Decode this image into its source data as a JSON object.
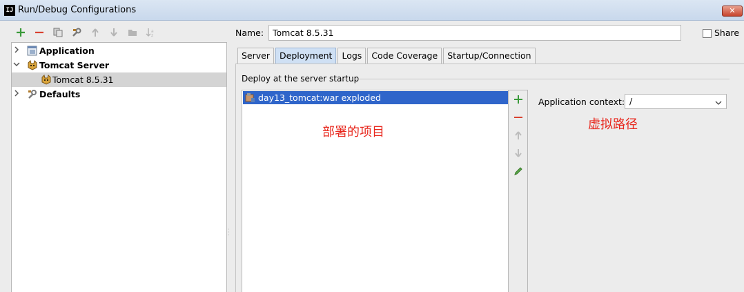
{
  "window": {
    "title": "Run/Debug Configurations",
    "app_icon_text": "IJ",
    "close_label": "✕"
  },
  "toolbar": {
    "icons": [
      "add-icon",
      "remove-icon",
      "copy-icon",
      "wrench-icon",
      "move-up-icon",
      "move-down-icon",
      "folder-icon",
      "sort-icon"
    ]
  },
  "tree": {
    "items": [
      {
        "label": "Application",
        "bold": true,
        "expanded": false
      },
      {
        "label": "Tomcat Server",
        "bold": true,
        "expanded": true
      },
      {
        "label": "Tomcat 8.5.31",
        "bold": false,
        "selected": true
      },
      {
        "label": "Defaults",
        "bold": true,
        "expanded": false
      }
    ]
  },
  "form": {
    "name_label": "Name:",
    "name_value": "Tomcat 8.5.31",
    "share_label": "Share",
    "share_checked": false
  },
  "tabs": [
    {
      "label": "Server",
      "active": false
    },
    {
      "label": "Deployment",
      "active": true
    },
    {
      "label": "Logs",
      "active": false
    },
    {
      "label": "Code Coverage",
      "active": false
    },
    {
      "label": "Startup/Connection",
      "active": false
    }
  ],
  "deployment": {
    "group_title": "Deploy at the server startup",
    "artifacts": [
      "day13_tomcat:war exploded"
    ],
    "context_label": "Application context:",
    "context_value": "/"
  },
  "annotations": {
    "project": "部署的项目",
    "virtual_path": "虚拟路径"
  },
  "colors": {
    "selection": "#2f65ca",
    "annotation": "#e8281e",
    "add_green": "#3a9a3a",
    "remove_red": "#d9412f"
  }
}
